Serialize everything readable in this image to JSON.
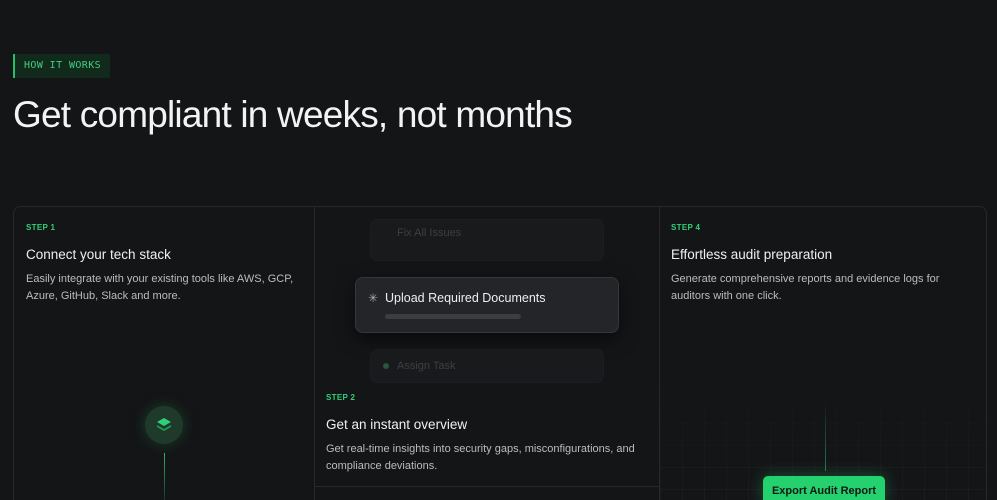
{
  "section": {
    "badge": "HOW IT WORKS",
    "headline": "Get compliant in weeks, not months"
  },
  "steps": [
    {
      "label": "STEP 1",
      "title": "Connect your tech stack",
      "description": "Easily integrate with your existing tools like AWS, GCP, Azure, GitHub, Slack and more."
    },
    {
      "label": "STEP 2",
      "title": "Get an instant overview",
      "description": "Get real-time insights into security gaps, misconfigurations, and compliance deviations."
    },
    {
      "label": "STEP 4",
      "title": "Effortless audit preparation",
      "description": "Generate comprehensive reports and evidence logs for auditors with one click."
    }
  ],
  "task_cards": {
    "top_ghost": "Fix All Issues",
    "active": "Upload Required Documents",
    "bottom_ghost": "Assign Task"
  },
  "buttons": {
    "export": "Export Audit Report"
  },
  "icons": {
    "integration": "layers-icon",
    "loading": "spinner-icon",
    "task_dot": "status-dot-icon"
  },
  "colors": {
    "background": "#141517",
    "accent": "#25d06f",
    "text": "#f2f3f4"
  }
}
